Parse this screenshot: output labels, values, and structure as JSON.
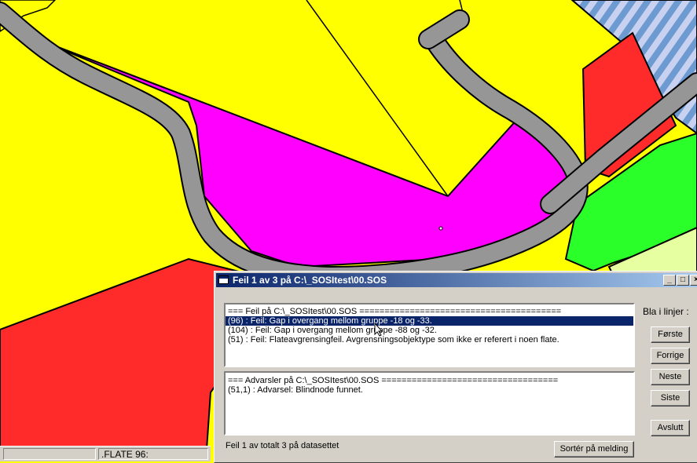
{
  "map": {
    "colors": {
      "yellow": "#ffff00",
      "magenta": "#ff00ff",
      "red": "#ff2a2a",
      "green": "#2aff2a",
      "pale_green": "#e6ffa0",
      "road": "#969696",
      "stripe_blue": "#6e9ad2",
      "stripe_light": "#c8d2f0"
    }
  },
  "statusbar": {
    "cell1": "",
    "cell2": ".FLATE 96:"
  },
  "dialog": {
    "title": "Feil 1 av 3 på C:\\_SOSItest\\00.SOS",
    "errors": [
      "=== Feil på C:\\_SOSItest\\00.SOS ========================================",
      "(96) : Feil: Gap i overgang mellom gruppe -18 og -33.",
      "(104) : Feil: Gap i overgang mellom gruppe -88 og -32.",
      "(51) : Feil: Flateavgrensingfeil. Avgrensningsobjektype som ikke er referert i noen flate."
    ],
    "warnings": [
      "=== Advarsler på C:\\_SOSItest\\00.SOS ===================================",
      "(51,1) : Advarsel: Blindnode funnet."
    ],
    "browse_label": "Bla i linjer :",
    "buttons": {
      "first": "Første",
      "previous": "Forrige",
      "next": "Neste",
      "last": "Siste",
      "close": "Avslutt",
      "sort": "Sortér på melding"
    },
    "footer": "Feil 1 av totalt 3 på datasettet"
  }
}
